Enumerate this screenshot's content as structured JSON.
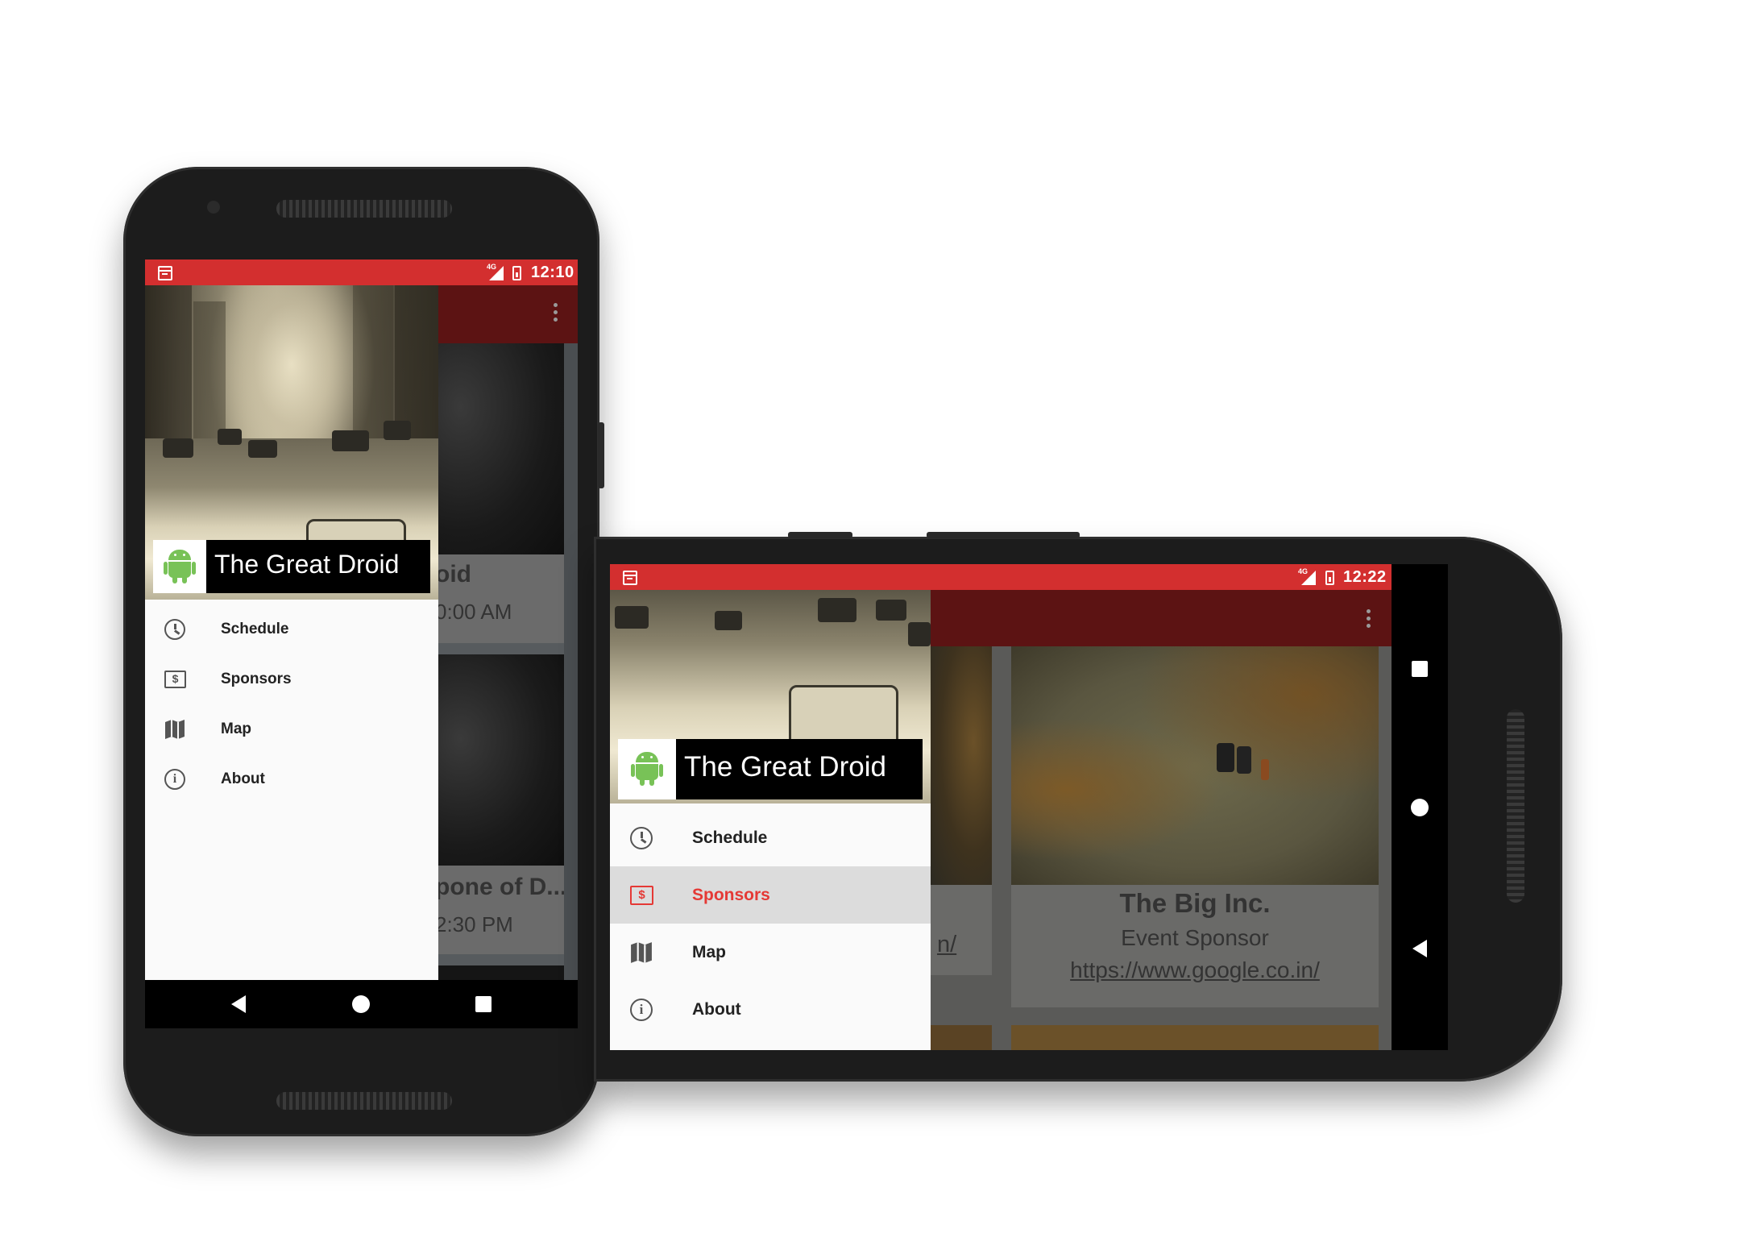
{
  "portrait": {
    "status": {
      "time": "12:10",
      "network": "4G"
    },
    "drawer": {
      "profile_name": "The Great Droid",
      "menu": [
        {
          "label": "Schedule",
          "icon": "clock-icon"
        },
        {
          "label": "Sponsors",
          "icon": "money-icon"
        },
        {
          "label": "Map",
          "icon": "map-icon"
        },
        {
          "label": "About",
          "icon": "info-icon"
        }
      ]
    },
    "background_cards": [
      {
        "title_fragment": "oid",
        "subtitle_fragment": "0:00 AM"
      },
      {
        "title_fragment": "pone of D...",
        "subtitle_fragment": "2:30 PM"
      }
    ]
  },
  "landscape": {
    "status": {
      "time": "12:22",
      "network": "4G"
    },
    "drawer": {
      "profile_name": "The Great Droid",
      "selected": "Sponsors",
      "menu": [
        {
          "label": "Schedule",
          "icon": "clock-icon"
        },
        {
          "label": "Sponsors",
          "icon": "money-icon"
        },
        {
          "label": "Map",
          "icon": "map-icon"
        },
        {
          "label": "About",
          "icon": "info-icon"
        }
      ]
    },
    "sponsor_card": {
      "name": "The Big Inc.",
      "type": "Event Sponsor",
      "url": "https://www.google.co.in/",
      "left_card_link_fragment": "n/"
    }
  },
  "icon_symbols": {
    "money": "$",
    "info": "i"
  },
  "colors": {
    "status_bar": "#d32f2f",
    "toolbar": "#5c1313",
    "accent": "#e53935",
    "droid_green": "#78c257"
  }
}
